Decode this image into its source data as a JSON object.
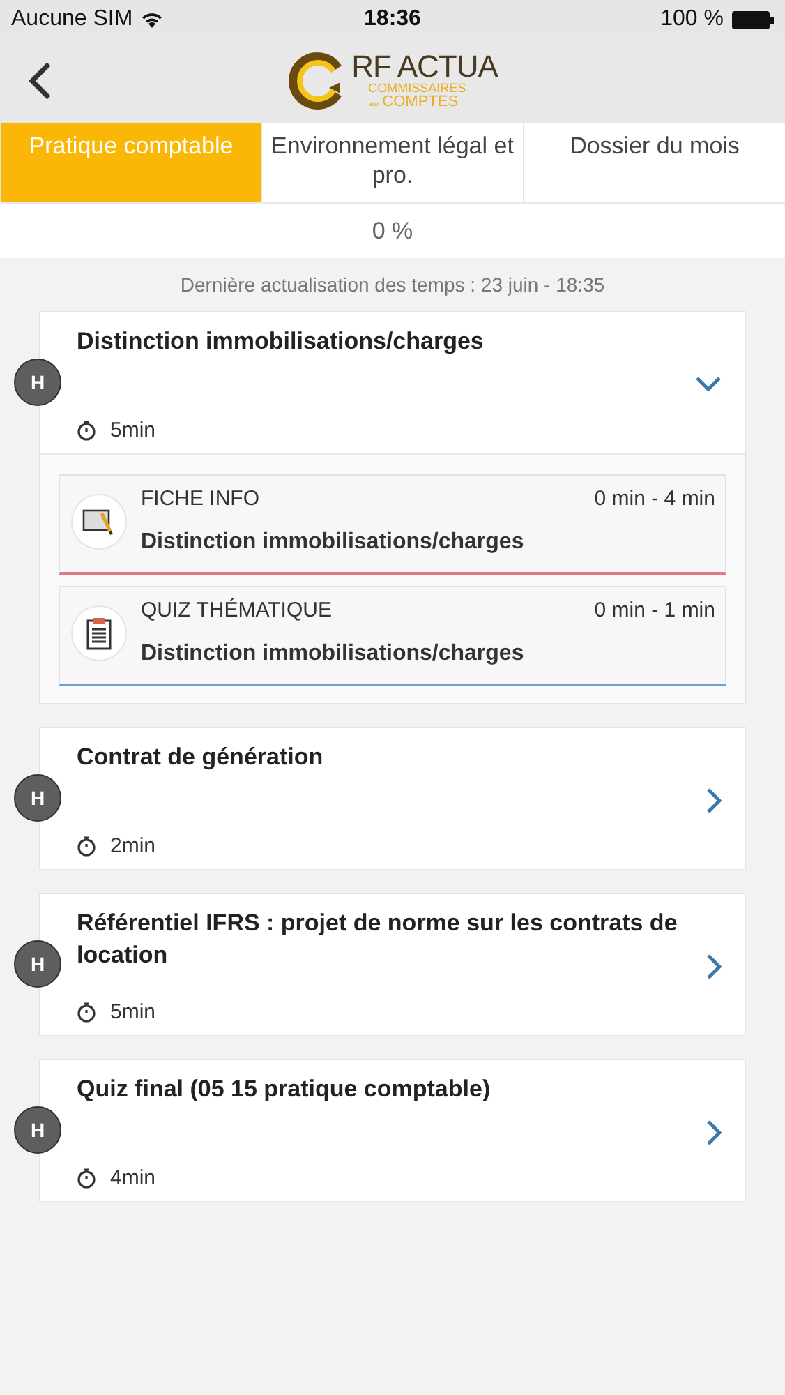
{
  "status_bar": {
    "carrier": "Aucune SIM",
    "time": "18:36",
    "battery": "100 %"
  },
  "logo": {
    "title": "RF ACTUA",
    "line_1": "COMMISSAIRES",
    "small": "aux",
    "line_2": "COMPTES"
  },
  "tabs": [
    {
      "label": "Pratique comptable",
      "selected": true
    },
    {
      "label": "Environnement légal et pro.",
      "selected": false
    },
    {
      "label": "Dossier du mois",
      "selected": false
    }
  ],
  "progress": "0 %",
  "last_update": "Dernière actualisation des temps : 23 juin - 18:35",
  "modules": [
    {
      "badge": "H",
      "title": "Distinction immobilisations/charges",
      "duration": "5min",
      "expanded": true,
      "items": [
        {
          "kind": "info",
          "type": "FICHE INFO",
          "range": "0 min - 4 min",
          "title": "Distinction immobilisations/charges",
          "color": "#e07a80"
        },
        {
          "kind": "quiz",
          "type": "QUIZ THÉMATIQUE",
          "range": "0 min - 1 min",
          "title": "Distinction immobilisations/charges",
          "color": "#6f9fd0"
        }
      ]
    },
    {
      "badge": "H",
      "title": "Contrat de génération",
      "duration": "2min",
      "expanded": false
    },
    {
      "badge": "H",
      "title": "Référentiel IFRS : projet de norme sur les contrats de location",
      "duration": "5min",
      "expanded": false
    },
    {
      "badge": "H",
      "title": "Quiz final (05 15 pratique comptable)",
      "duration": "4min",
      "expanded": false
    }
  ]
}
